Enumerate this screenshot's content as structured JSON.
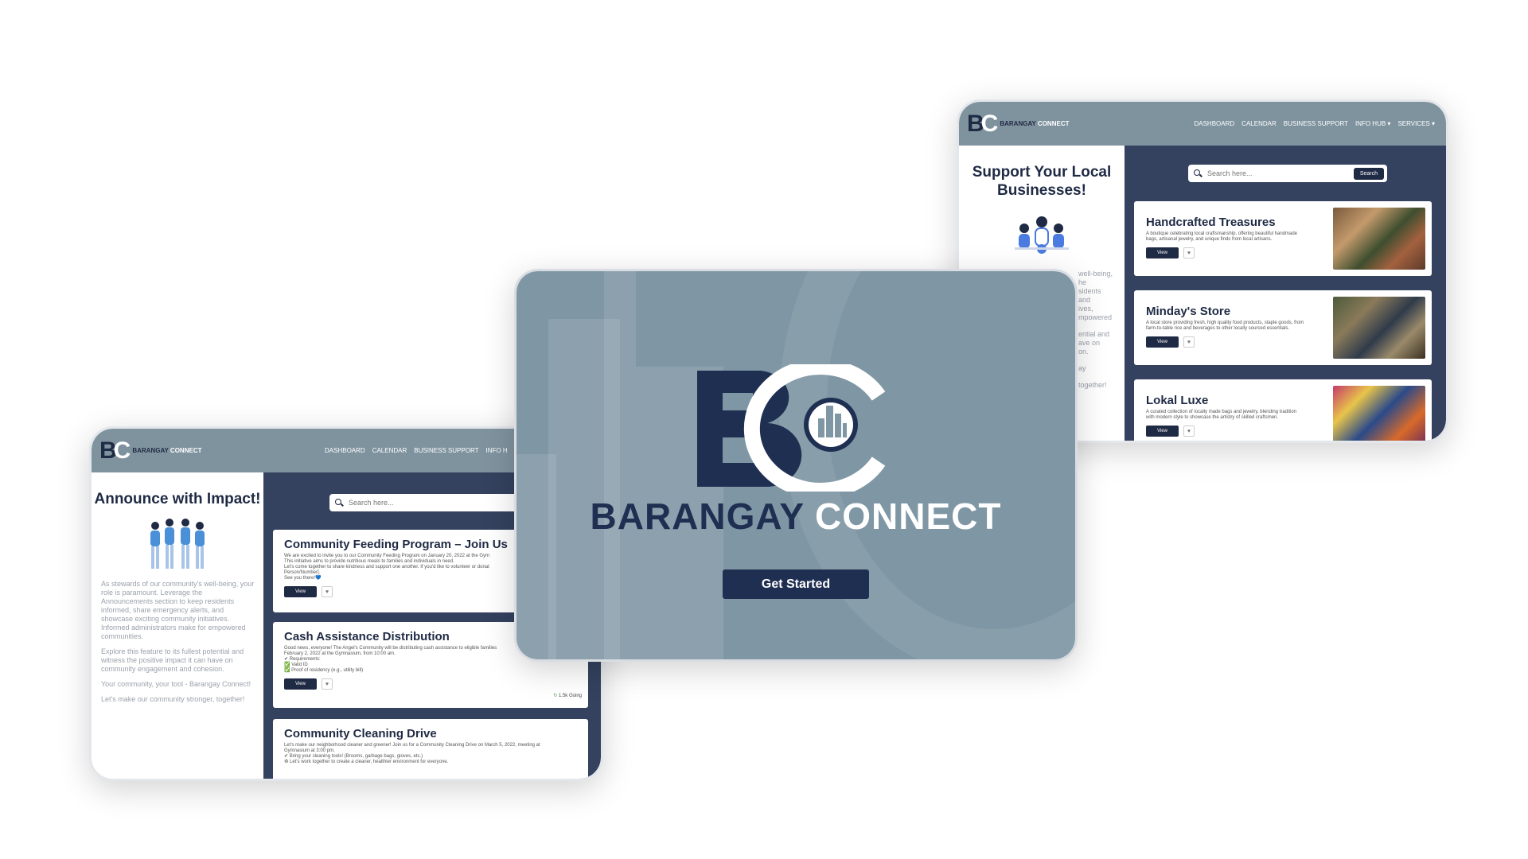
{
  "brand": {
    "word1": "BARANGAY",
    "word2": "CONNECT",
    "mono_b": "B",
    "mono_c": "C"
  },
  "nav_right": [
    "DASHBOARD",
    "CALENDAR",
    "BUSINESS SUPPORT",
    "INFO HUB ▾",
    "SERVICES ▾"
  ],
  "nav_left": [
    "DASHBOARD",
    "CALENDAR",
    "BUSINESS SUPPORT",
    "INFO H"
  ],
  "splash": {
    "title_part1": "BARANGAY",
    "title_part2": "CONNECT",
    "cta": "Get Started"
  },
  "right_page": {
    "heading": "Support Your Local Businesses!",
    "side_text": [
      "well-being,",
      "he",
      "sidents",
      "and",
      "ives,",
      "mpowered",
      "",
      "ential and",
      "ave on",
      "on.",
      "",
      "ay",
      "",
      "together!"
    ],
    "search_placeholder": "Search here...",
    "search_button": "Search",
    "cards": [
      {
        "title": "Handcrafted Treasures",
        "desc": "A boutique celebrating local craftsmanship, offering beautiful handmade bags, artisanal jewelry, and unique finds from local artisans.",
        "view": "View"
      },
      {
        "title": "Minday's Store",
        "desc": "A local store providing fresh, high quality food products, staple goods, from farm-to-table rice and beverages to other locally sourced essentials.",
        "view": "View"
      },
      {
        "title": "Lokal Luxe",
        "desc": "A curated collection of locally made bags and jewelry, blending tradition with modern style to showcase the artistry of skilled craftsmen.",
        "view": "View"
      }
    ]
  },
  "left_page": {
    "heading": "Announce with Impact!",
    "paragraphs": [
      "As stewards of our community's well-being, your role is paramount. Leverage the Announcements section to keep residents informed, share emergency alerts, and showcase exciting community initiatives. Informed administrators make for empowered communities.",
      "Explore this feature to its fullest potential and witness the positive impact it can have on community engagement and cohesion.",
      "Your community, your tool - Barangay Connect!",
      "Let's make our community stronger, together!"
    ],
    "search_placeholder": "Search here...",
    "cards": [
      {
        "title": "Community Feeding Program – Join Us",
        "lines": [
          "We are excited to invite you to our Community Feeding Program on January 20, 2022 at the Gym",
          "This initiative aims to provide nutritious meals to families and individuals in need.",
          "Let's come together to share kindness and support one another. If you'd like to volunteer or donat",
          "Person/Number].",
          "See you there!💙"
        ],
        "view": "View"
      },
      {
        "title": "Cash Assistance Distribution",
        "lines": [
          "Good news, everyone! The Angel's Community will be distributing cash assistance to eligible families",
          "February 2, 2022 at the Gymnasium, from 10:00 am.",
          "✔ Requirements:",
          "✅ Valid ID",
          "✅ Proof of residency (e.g., utility bill)"
        ],
        "view": "View",
        "going": "1.5k Going"
      },
      {
        "title": "Community Cleaning Drive",
        "lines": [
          "Let's make our neighborhood cleaner and greener! Join us for a Community Cleaning Drive on March 5, 2022, meeting at",
          "Gymnasium at 3:00 pm.",
          "✔ Bring your cleaning tools! (Brooms, garbage bags, gloves, etc.)",
          "♻ Let's work together to create a cleaner, healthier environment for everyone."
        ]
      }
    ]
  },
  "colors": {
    "navy": "#1f2a44",
    "slate": "#7f939f",
    "panel": "#34425f",
    "splash": "#7f97a4"
  }
}
